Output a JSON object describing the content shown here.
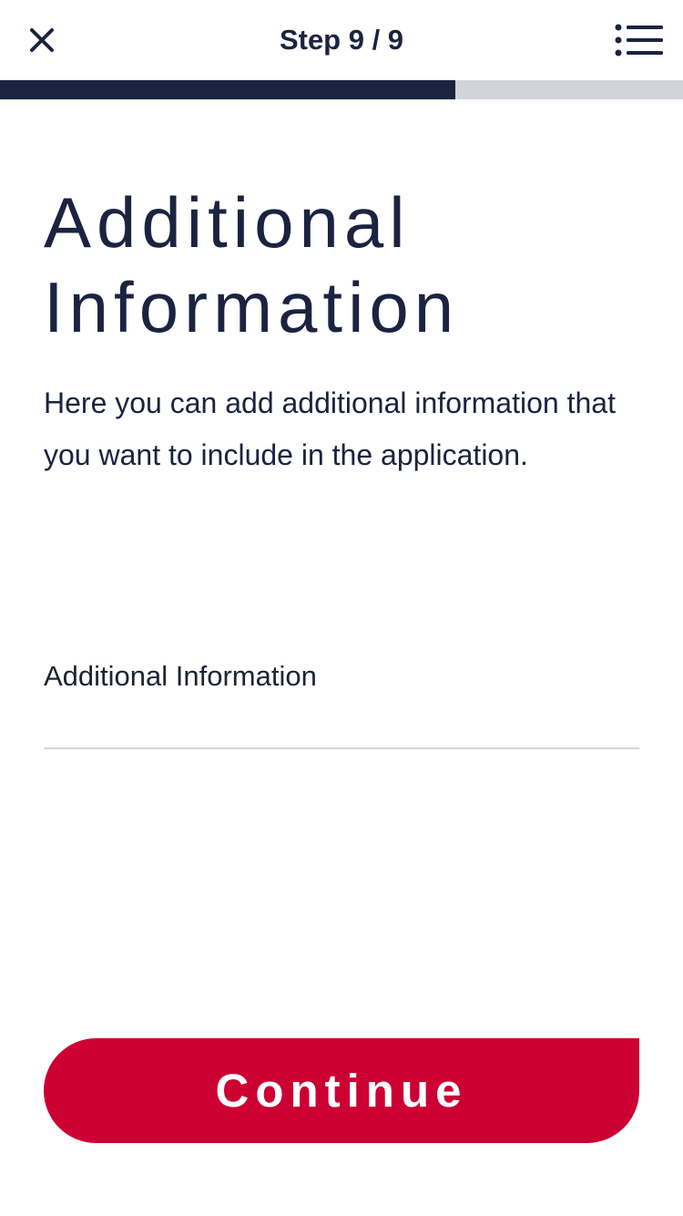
{
  "header": {
    "step_label": "Step 9 / 9",
    "close_icon": "close-icon",
    "menu_icon": "list-icon"
  },
  "progress": {
    "fraction": 0.667
  },
  "main": {
    "title": "Additional Information",
    "description": "Here you can add additional information that you want to include in the application."
  },
  "form": {
    "additional_info_label": "Additional Information",
    "additional_info_value": "",
    "additional_info_placeholder": ""
  },
  "footer": {
    "continue_label": "Continue"
  },
  "colors": {
    "primary_navy": "#1b2340",
    "accent_red": "#cc0033",
    "progress_track": "#d3d4d9"
  }
}
